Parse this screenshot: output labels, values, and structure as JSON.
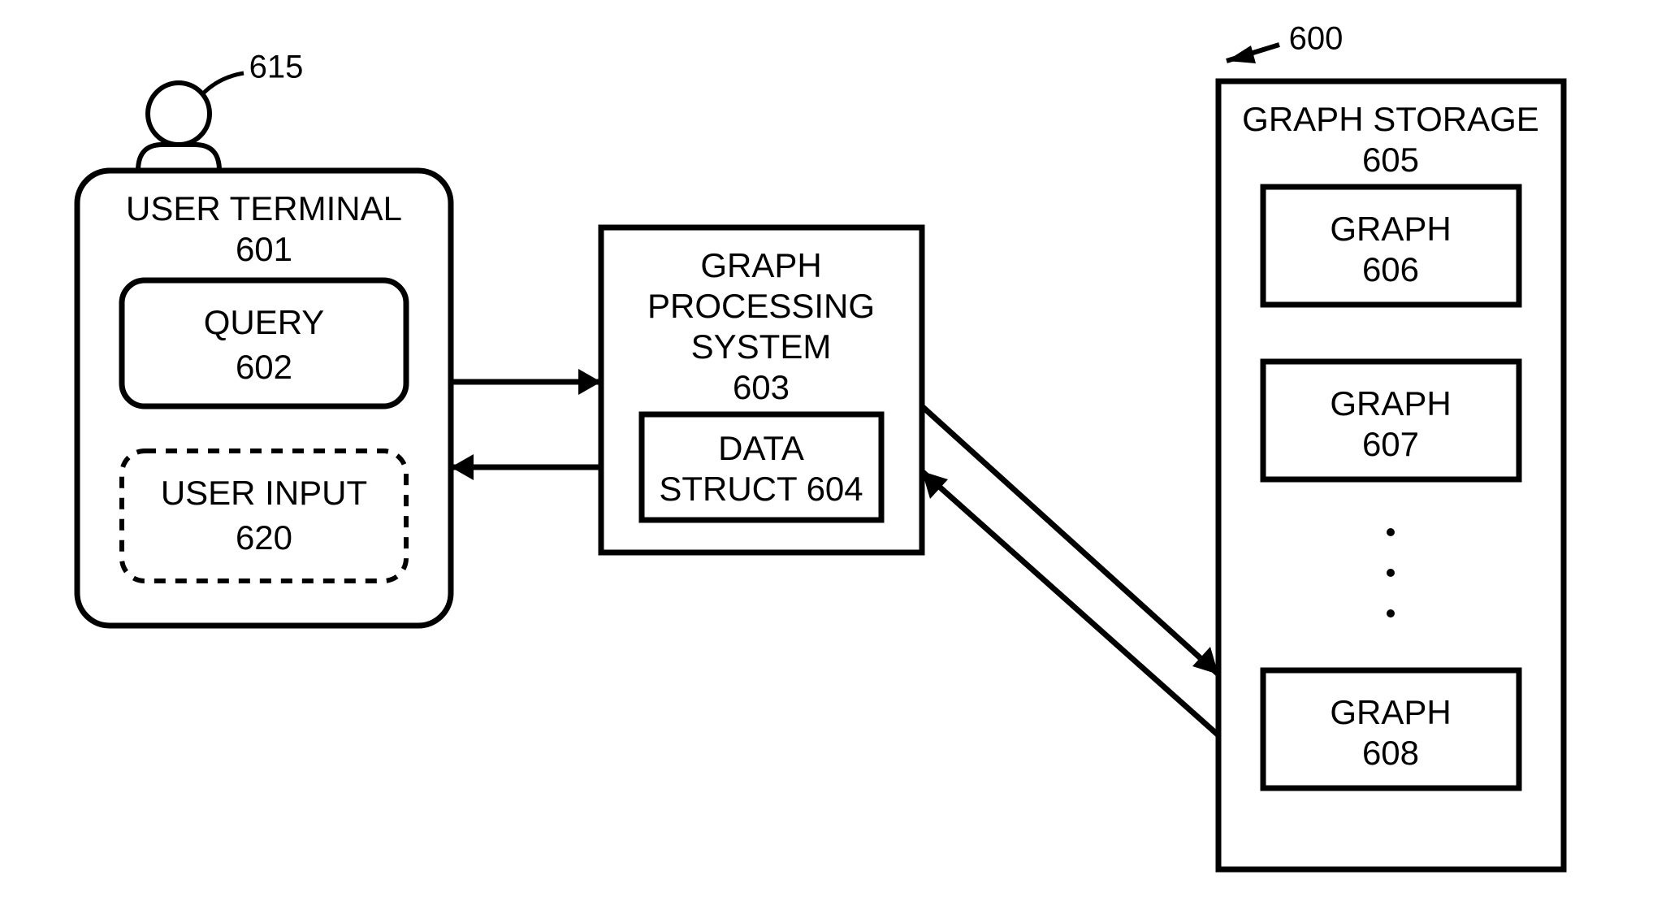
{
  "figure_ref": "600",
  "user_icon_ref": "615",
  "user_terminal": {
    "title": "USER TERMINAL",
    "ref": "601",
    "query": {
      "title": "QUERY",
      "ref": "602"
    },
    "user_input": {
      "title": "USER INPUT",
      "ref": "620"
    }
  },
  "processing": {
    "line1": "GRAPH",
    "line2": "PROCESSING",
    "line3": "SYSTEM",
    "ref": "603",
    "data_struct_line1": "DATA",
    "data_struct_line2": "STRUCT 604"
  },
  "storage": {
    "title": "GRAPH STORAGE",
    "ref": "605",
    "graph1": {
      "title": "GRAPH",
      "ref": "606"
    },
    "graph2": {
      "title": "GRAPH",
      "ref": "607"
    },
    "graph3": {
      "title": "GRAPH",
      "ref": "608"
    }
  }
}
